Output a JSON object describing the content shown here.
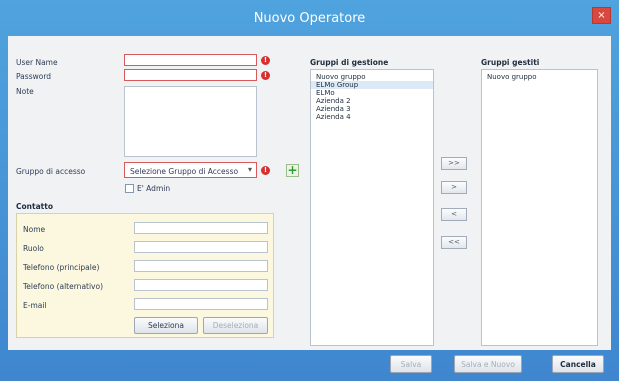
{
  "window": {
    "title": "Nuovo Operatore",
    "close_label": "×"
  },
  "form": {
    "username_label": "User Name",
    "password_label": "Password",
    "note_label": "Note",
    "access_group_label": "Gruppo di accesso",
    "access_group_value": "Selezione Gruppo di Accesso",
    "admin_label": "E' Admin",
    "error_marker": "!"
  },
  "contatto": {
    "title": "Contatto",
    "fields": [
      "Nome",
      "Ruolo",
      "Telefono (principale)",
      "Telefono (alternativo)",
      "E-mail"
    ],
    "select_button": "Seleziona",
    "deselect_button": "Deseleziona"
  },
  "gestione": {
    "title": "Gruppi di gestione",
    "items": [
      "Nuovo gruppo",
      "ELMo Group",
      "ELMo",
      "Azienda 2",
      "Azienda 3",
      "Azienda 4"
    ],
    "selected_index": 1
  },
  "transfer": {
    "all_right": ">>",
    "right": ">",
    "left": "<",
    "all_left": "<<"
  },
  "gestiti": {
    "title": "Gruppi gestiti",
    "items": [
      "Nuovo gruppo"
    ]
  },
  "footer": {
    "save": "Salva",
    "save_new": "Salva e Nuovo",
    "cancel": "Cancella"
  }
}
